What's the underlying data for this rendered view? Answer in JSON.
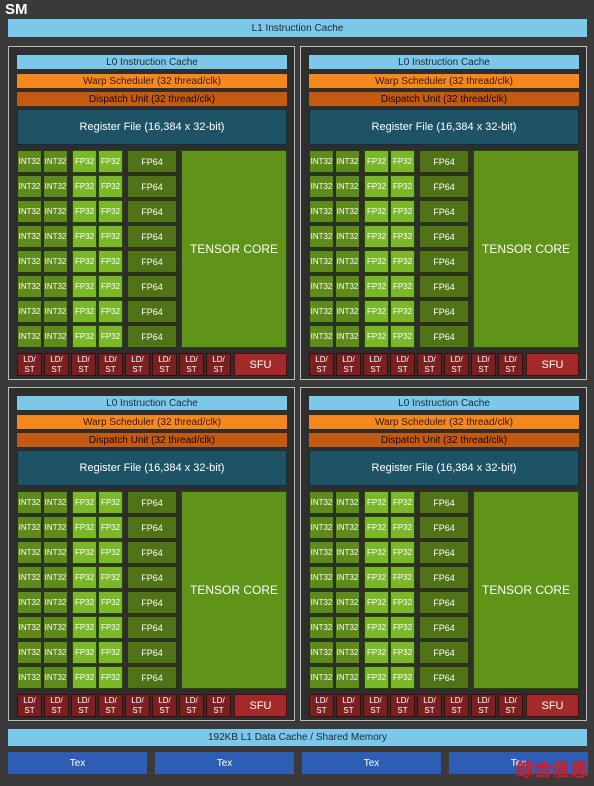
{
  "title": "SM",
  "l1_instruction_cache": "L1 Instruction Cache",
  "partition": {
    "l0_cache": "L0 Instruction Cache",
    "warp_scheduler": "Warp Scheduler (32 thread/clk)",
    "dispatch_unit": "Dispatch Unit (32 thread/clk)",
    "register_file": "Register File (16,384 x 32-bit)",
    "int32": "INT32",
    "fp32": "FP32",
    "fp64": "FP64",
    "tensor_core": "TENSOR CORE",
    "ldst": "LD/\nST",
    "sfu": "SFU",
    "unit_rows": 8,
    "ldst_count": 8
  },
  "partition_count": 4,
  "l1_data_cache": "192KB L1 Data Cache / Shared Memory",
  "tex_units": [
    "Tex",
    "Tex",
    "Tex",
    "Tex"
  ],
  "watermark": "综合信息",
  "colors": {
    "cache": "#7cc8ea",
    "warp_scheduler": "#f5871f",
    "dispatch_unit": "#c25a12",
    "register_file": "#1e5366",
    "int32": "#5f8a1c",
    "fp32": "#7ab82a",
    "fp64": "#4f7316",
    "tensor_core": "#5f9418",
    "ldst": "#7a2020",
    "sfu": "#a42a2a",
    "tex": "#2e5db5"
  }
}
